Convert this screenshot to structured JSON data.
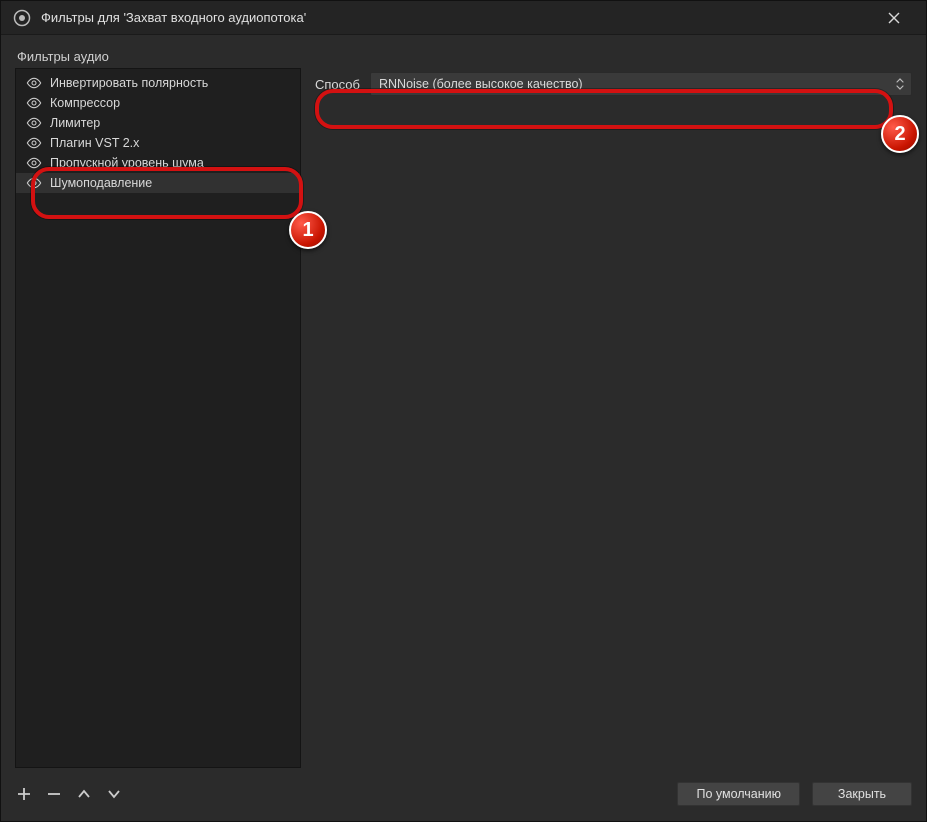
{
  "titlebar": {
    "title": "Фильтры для 'Захват входного аудиопотока'"
  },
  "section_label": "Фильтры аудио",
  "filters": [
    {
      "label": "Инвертировать полярность",
      "selected": false
    },
    {
      "label": "Компрессор",
      "selected": false
    },
    {
      "label": "Лимитер",
      "selected": false
    },
    {
      "label": "Плагин VST 2.x",
      "selected": false
    },
    {
      "label": "Пропускной уровень шума",
      "selected": false
    },
    {
      "label": "Шумоподавление",
      "selected": true
    }
  ],
  "property": {
    "label": "Способ",
    "value": "RNNoise (более высокое качество)"
  },
  "footer": {
    "defaults_btn": "По умолчанию",
    "close_btn": "Закрыть"
  },
  "annotations": {
    "badge1": "1",
    "badge2": "2"
  }
}
